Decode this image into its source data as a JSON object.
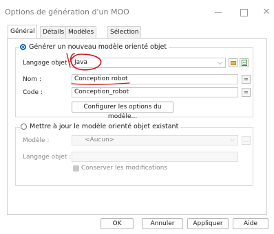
{
  "window": {
    "title": "Options de génération d'un MOO",
    "minimize_icon": "minimize-icon",
    "maximize_icon": "maximize-icon",
    "close_icon": "close-icon"
  },
  "tabs": [
    {
      "label": "Général",
      "active": true
    },
    {
      "label": "Détails",
      "active": false
    },
    {
      "label": "Modèles cible",
      "active": false
    },
    {
      "label": "Sélection",
      "active": false
    }
  ],
  "generate_group": {
    "label": "Générer un nouveau modèle orienté objet",
    "selected": true,
    "language_label": "Langage objet :",
    "language_value": "Java",
    "name_label": "Nom :",
    "name_value": "Conception robot",
    "code_label": "Code :",
    "code_value": "Conception_robot",
    "configure_button": "Configurer les options du modèle...",
    "equals_label": "="
  },
  "update_group": {
    "label": "Mettre à jour le modèle orienté objet existant",
    "selected": false,
    "model_label": "Modèle :",
    "model_value": "<Aucun>",
    "language_label": "Langage objet :",
    "language_value": "",
    "keep_changes_label": "Conserver les modifications",
    "keep_changes_checked": true,
    "ellipsis_label": "..."
  },
  "footer": {
    "ok": "OK",
    "cancel": "Annuler",
    "apply": "Appliquer",
    "help": "Aide"
  },
  "colors": {
    "accent": "#0067c0",
    "annotation_red": "#d0131a"
  }
}
